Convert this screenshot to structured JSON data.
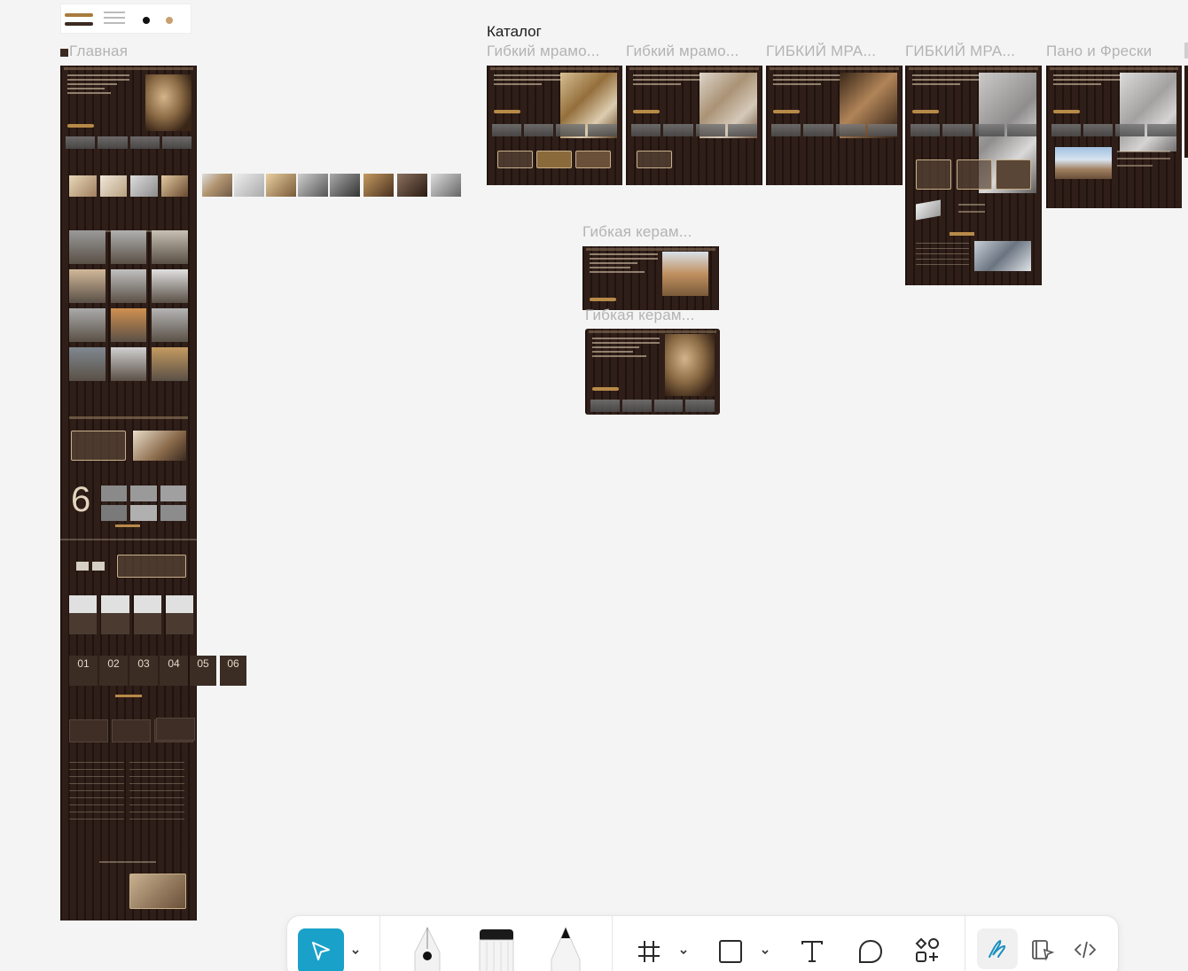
{
  "canvas": {
    "background": "#f4f4f4",
    "section_catalog": "Каталог"
  },
  "frames": {
    "main": "Главная",
    "catalog": [
      "Гибкий мрамо...",
      "Гибкий мрамо...",
      "ГИБКИЙ МРА...",
      "ГИБКИЙ МРА...",
      "Пано и Фрески"
    ],
    "ceramic_1": "Гибкая керам...",
    "ceramic_2": "Гибкая керам..."
  },
  "main_frame_text": {
    "big_number": "6",
    "steps": [
      "01",
      "02",
      "03",
      "04",
      "05",
      "06"
    ]
  },
  "toolbar": {
    "accent": "#1aa1c9",
    "tools": [
      "move-icon",
      "pen-icon",
      "brush-icon",
      "pencil-icon",
      "frame-icon",
      "rectangle-icon",
      "text-icon",
      "comment-icon",
      "components-icon",
      "draw-mode-icon",
      "dev-mode-icon",
      "code-icon"
    ]
  }
}
